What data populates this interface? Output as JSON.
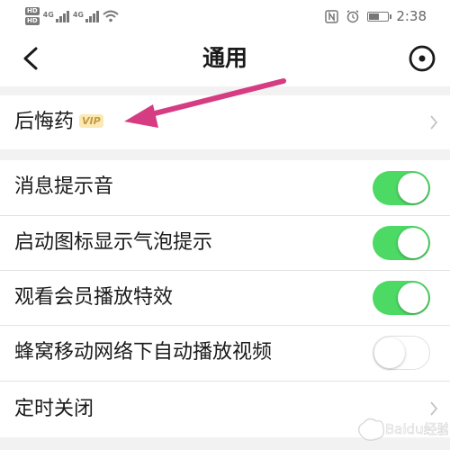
{
  "status_bar": {
    "hd_1": "HD",
    "hd_2": "HD",
    "net_1": "4G",
    "net_2": "4G",
    "time": "2:38",
    "battery_level": 0.55,
    "icons": [
      "nfc-icon",
      "alarm-icon",
      "battery-icon",
      "wifi-icon",
      "signal-icon"
    ]
  },
  "nav": {
    "title": "通用",
    "back_icon": "chevron-left-icon",
    "more_icon": "target-circle-icon"
  },
  "settings": {
    "regret": {
      "label": "后悔药",
      "badge": "VIP"
    },
    "toggles": [
      {
        "label": "消息提示音",
        "on": true
      },
      {
        "label": "启动图标显示气泡提示",
        "on": true
      },
      {
        "label": "观看会员播放特效",
        "on": true
      },
      {
        "label": "蜂窝移动网络下自动播放视频",
        "on": false
      }
    ],
    "timer": {
      "label": "定时关闭"
    }
  },
  "colors": {
    "switch_on": "#4cd964",
    "annotation_arrow": "#d63c82",
    "vip_text": "#c49a3c",
    "vip_bg": "#fbe9b5"
  },
  "watermark": {
    "text": "Baidu经验"
  }
}
